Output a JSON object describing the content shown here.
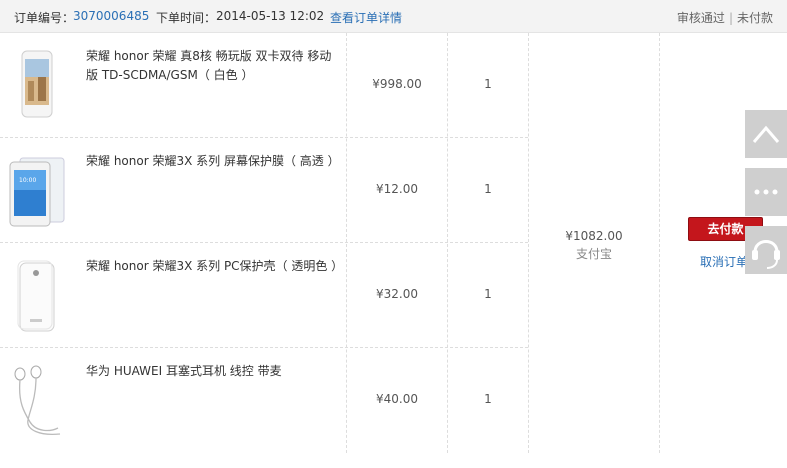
{
  "header": {
    "order_no_label": "订单编号：",
    "order_no": "3070006485",
    "time_label": "下单时间：",
    "time": "2014-05-13 12:02",
    "detail_link": "查看订单详情",
    "status_approved": "审核通过",
    "status_sep": "|",
    "status_unpaid": "未付款"
  },
  "items": [
    {
      "name": "荣耀 honor 荣耀 真8核 畅玩版 双卡双待 移动版 TD-SCDMA/GSM（ 白色 ）",
      "price": "¥998.00",
      "qty": "1",
      "icon": "white-phone-image"
    },
    {
      "name": "荣耀 honor 荣耀3X 系列 屏幕保护膜（ 高透 ）",
      "price": "¥12.00",
      "qty": "1",
      "icon": "screen-protector-image"
    },
    {
      "name": "荣耀 honor 荣耀3X 系列 PC保护壳（ 透明色 ）",
      "price": "¥32.00",
      "qty": "1",
      "icon": "phone-case-image"
    },
    {
      "name": "华为 HUAWEI 耳塞式耳机 线控 带麦",
      "price": "¥40.00",
      "qty": "1",
      "icon": "earphones-image"
    }
  ],
  "summary": {
    "total": "¥1082.00",
    "pay_method": "支付宝"
  },
  "actions": {
    "pay_label": "去付款",
    "cancel_label": "取消订单"
  },
  "sidebar": {
    "icons": [
      "chevron-up-icon",
      "more-icon",
      "headset-icon"
    ]
  },
  "colors": {
    "link": "#2a6fb5",
    "pay_button": "#c4161c",
    "header_bg": "#f3f3f3"
  }
}
